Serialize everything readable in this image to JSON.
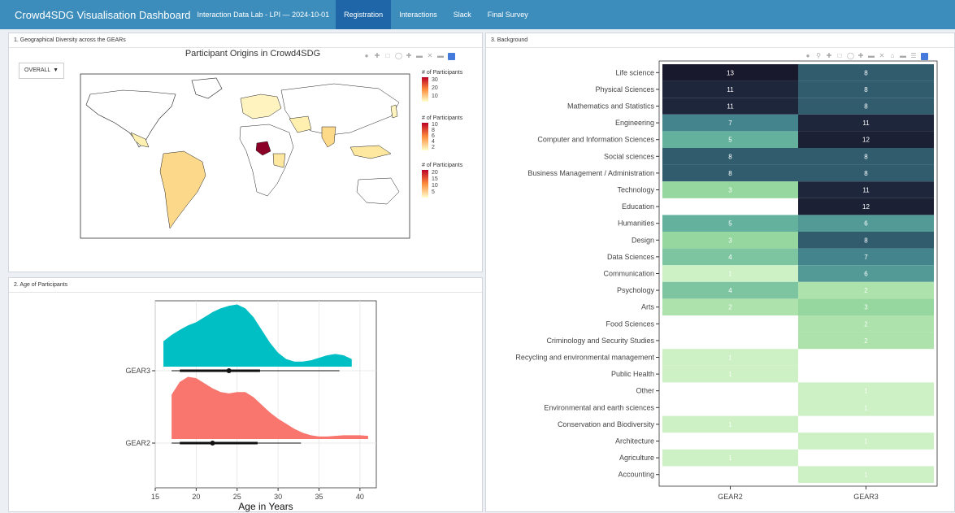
{
  "navbar": {
    "brand": "Crowd4SDG Visualisation Dashboard",
    "subtitle": "Interaction Data Lab - LPI — 2024-10-01",
    "tabs": [
      {
        "label": "Registration",
        "active": true
      },
      {
        "label": "Interactions",
        "active": false
      },
      {
        "label": "Slack",
        "active": false
      },
      {
        "label": "Final Survey",
        "active": false
      }
    ],
    "color": "#3c8dbc",
    "active_color": "#1e66a8"
  },
  "panel1": {
    "title": "1. Geographical Diversity across the GEARs",
    "select_value": "OVERALL",
    "plot_title": "Participant Origins in Crowd4SDG",
    "legends": [
      {
        "title": "# of Participants",
        "ticks": [
          "30",
          "20",
          "10"
        ]
      },
      {
        "title": "# of Participants",
        "ticks": [
          "10",
          "8",
          "6",
          "4",
          "2"
        ]
      },
      {
        "title": "# of Participants",
        "ticks": [
          "20",
          "15",
          "10",
          "5"
        ]
      }
    ]
  },
  "panel2": {
    "title": "2. Age of Participants",
    "xlabel": "Age in Years"
  },
  "panel3": {
    "title": "3. Background"
  },
  "chart_data": [
    {
      "type": "raincloud",
      "title": "",
      "xlabel": "Age in Years",
      "ylabel": "",
      "xlim": [
        15,
        42
      ],
      "xticks": [
        15,
        20,
        25,
        30,
        35,
        40
      ],
      "categories": [
        "GEAR3",
        "GEAR2"
      ],
      "series": [
        {
          "name": "GEAR3",
          "color": "#00bfc4",
          "median": 24,
          "q1": 18,
          "q3": 27.8,
          "min": 17,
          "max": 37.5,
          "density_x": [
            16,
            17,
            18,
            19,
            20,
            21,
            22,
            23,
            24,
            25,
            26,
            27,
            28,
            29,
            30,
            31,
            32,
            33,
            34,
            35,
            36,
            37,
            38,
            39
          ],
          "density_y": [
            0.4,
            0.5,
            0.58,
            0.65,
            0.7,
            0.78,
            0.86,
            0.92,
            0.96,
            0.98,
            0.92,
            0.78,
            0.58,
            0.38,
            0.22,
            0.12,
            0.08,
            0.08,
            0.1,
            0.14,
            0.18,
            0.2,
            0.18,
            0.12
          ]
        },
        {
          "name": "GEAR2",
          "color": "#f8766d",
          "median": 22,
          "q1": 18,
          "q3": 27.5,
          "min": 17,
          "max": 32.8,
          "density_x": [
            17,
            18,
            19,
            20,
            21,
            22,
            23,
            24,
            25,
            26,
            27,
            28,
            29,
            30,
            31,
            32,
            33,
            34,
            35,
            36,
            37,
            38,
            39,
            40,
            41
          ],
          "density_y": [
            0.7,
            0.9,
            0.98,
            0.96,
            0.88,
            0.8,
            0.74,
            0.72,
            0.74,
            0.74,
            0.66,
            0.54,
            0.42,
            0.32,
            0.24,
            0.16,
            0.1,
            0.06,
            0.04,
            0.04,
            0.05,
            0.06,
            0.06,
            0.06,
            0.05
          ]
        }
      ]
    },
    {
      "type": "heatmap",
      "title": "",
      "x": [
        "GEAR2",
        "GEAR3"
      ],
      "y": [
        "Life science",
        "Physical Sciences",
        "Mathematics and Statistics",
        "Engineering",
        "Computer and Information Sciences",
        "Social sciences",
        "Business Management / Administration",
        "Technology",
        "Education",
        "Humanities",
        "Design",
        "Data Sciences",
        "Communication",
        "Psychology",
        "Arts",
        "Food Sciences",
        "Criminology and Security Studies",
        "Recycling and environmental management",
        "Public Health",
        "Other",
        "Environmental and earth sciences",
        "Conservation and Biodiversity",
        "Architecture",
        "Agriculture",
        "Accounting"
      ],
      "values": [
        [
          13,
          8
        ],
        [
          11,
          8
        ],
        [
          11,
          8
        ],
        [
          7,
          11
        ],
        [
          5,
          12
        ],
        [
          8,
          8
        ],
        [
          8,
          8
        ],
        [
          3,
          11
        ],
        [
          null,
          12
        ],
        [
          5,
          6
        ],
        [
          3,
          8
        ],
        [
          4,
          7
        ],
        [
          1,
          6
        ],
        [
          4,
          2
        ],
        [
          2,
          3
        ],
        [
          null,
          2
        ],
        [
          null,
          2
        ],
        [
          1,
          null
        ],
        [
          1,
          null
        ],
        [
          null,
          1
        ],
        [
          null,
          1
        ],
        [
          1,
          null
        ],
        [
          null,
          1
        ],
        [
          1,
          null
        ],
        [
          null,
          1
        ]
      ]
    }
  ]
}
